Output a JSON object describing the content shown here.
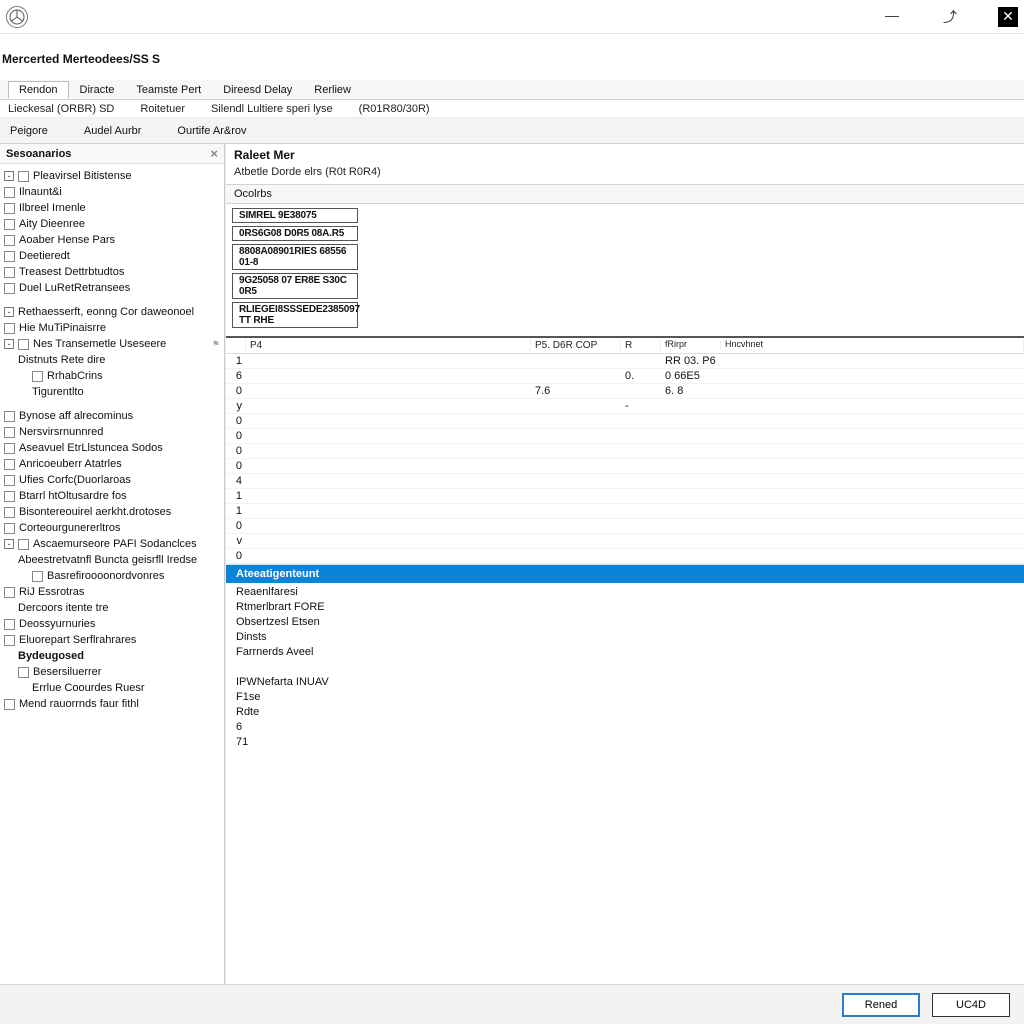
{
  "title": "Mercerted Merteodees/SS S",
  "window_controls": {
    "minimize": "—",
    "restore": "⤴",
    "close": "✕"
  },
  "ribbon": {
    "tabs": [
      "Rendon",
      "Diracte",
      "Teamste Pert",
      "Direesd Delay",
      "Rerliew"
    ],
    "sub": {
      "a": "Lieckesal (ORBR) SD",
      "b": "Roitetuer",
      "c": "Silendl Lultiere speri lyse",
      "d": "(R01R80/30R)"
    }
  },
  "toolbar": {
    "a": "Peigore",
    "b": "Audel Aurbr",
    "c": "Ourtife Ar&rov"
  },
  "sidebar": {
    "title": "Sesoanarios",
    "nodes": [
      {
        "exp": "-",
        "icon": true,
        "label": "Pleavirsel Bitistense",
        "indent": 0
      },
      {
        "icon": true,
        "label": "Ilnaunt&i",
        "indent": 0
      },
      {
        "icon": true,
        "label": "Ilbreel Irnenle",
        "indent": 0
      },
      {
        "icon": true,
        "label": "Aity Dieenree",
        "indent": 0
      },
      {
        "icon": true,
        "label": "Aoaber Hense Pars",
        "indent": 0
      },
      {
        "icon": true,
        "label": "Deetieredt",
        "indent": 0
      },
      {
        "icon": true,
        "label": "Treasest Dettrbtudtos",
        "indent": 0
      },
      {
        "icon": true,
        "label": "Duel LuRetRetransees",
        "indent": 0
      },
      {
        "blank": true
      },
      {
        "exp": "-",
        "label": "Rethaesserft, eonng Cor daweonoel",
        "indent": 0
      },
      {
        "icon": true,
        "label": "Hie MuTiPinaisrre",
        "indent": 0
      },
      {
        "exp": "-",
        "icon": true,
        "label": "Nes Transemetle Useseere",
        "indent": 0,
        "pin": true
      },
      {
        "label": "Distnuts Rete dire",
        "indent": 1
      },
      {
        "icon": true,
        "label": "RrhabCrins",
        "indent": 2
      },
      {
        "label": "Tigurentlto",
        "indent": 2
      },
      {
        "blank": true
      },
      {
        "icon": true,
        "label": "Bynose aff alrecominus",
        "indent": 0
      },
      {
        "icon": true,
        "label": "Nersvirsrnunnred",
        "indent": 0
      },
      {
        "icon": true,
        "label": "Aseavuel EtrLlstuncea Sodos",
        "indent": 0
      },
      {
        "icon": true,
        "label": "Anricoeuberr Atatrles",
        "indent": 0
      },
      {
        "icon": true,
        "label": "Ufies Corfc(Duorlaroas",
        "indent": 0
      },
      {
        "icon": true,
        "label": "Btarrl htOltusardre fos",
        "indent": 0
      },
      {
        "icon": true,
        "label": "Bisontereouirel aerkht.drotoses",
        "indent": 0
      },
      {
        "icon": true,
        "label": "Corteourgunererltros",
        "indent": 0
      },
      {
        "exp": "-",
        "icon": true,
        "label": "Ascaemurseore PAFI Sodanclces",
        "indent": 0
      },
      {
        "label": "Abeestretvatnfl Buncta geisrfll Iredse",
        "indent": 1
      },
      {
        "icon": true,
        "label": "Basrefiroooonordvonres",
        "indent": 2
      },
      {
        "icon": true,
        "label": "RiJ Essrotras",
        "indent": 0
      },
      {
        "label": "Dercoors itente tre",
        "indent": 1
      },
      {
        "icon": true,
        "label": "Deossyurnuries",
        "indent": 0
      },
      {
        "icon": true,
        "label": "Eluorepart Serflrahrares",
        "indent": 0
      },
      {
        "label": "Bydeugosed",
        "indent": 1,
        "bold": true
      },
      {
        "icon": true,
        "label": "Besersiluerrer",
        "indent": 1
      },
      {
        "label": "Errlue Coourdes Ruesr",
        "indent": 2
      },
      {
        "icon": true,
        "label": "Mend rauorrnds faur fithl",
        "indent": 0
      }
    ]
  },
  "content": {
    "header": "Raleet Mer",
    "subheader": "Atbetle Dorde elrs (R0t R0R4)",
    "section": "Ocolrbs",
    "commands": [
      "SIMREL 9E38075",
      "0RS6G08 D0R5 08A.R5",
      "8808A08901RIES 68556 01-8",
      "9G25058 07 ER8E S30C 0R5",
      "RLIEGEI8SSSEDE2385097 TT RHE"
    ],
    "grid": {
      "headers": {
        "c0": "",
        "c1": "P4",
        "c2": "P5. D6R COP",
        "c3": "R",
        "c4": "fRirpr",
        "c5": "Hncvhnet"
      },
      "rows": [
        {
          "c0": "1",
          "c1": "",
          "c2": "",
          "c3": "",
          "c4": "RR 03. P6",
          "c5": ""
        },
        {
          "c0": "6",
          "c1": "",
          "c2": "",
          "c3": "0.",
          "c4": "0 66E5",
          "c5": ""
        },
        {
          "c0": "0",
          "c1": "",
          "c2": "7.6",
          "c3": "",
          "c4": "6. 8",
          "c5": ""
        },
        {
          "c0": "y",
          "c1": "",
          "c2": "",
          "c3": "-",
          "c4": "",
          "c5": ""
        },
        {
          "c0": "0"
        },
        {
          "c0": "0"
        },
        {
          "c0": "0"
        },
        {
          "c0": "0"
        },
        {
          "c0": "4"
        },
        {
          "c0": "1"
        },
        {
          "c0": "1"
        },
        {
          "c0": "0"
        },
        {
          "c0": "v"
        },
        {
          "c0": "0"
        }
      ]
    },
    "blue_header": "Ateeatigenteunt",
    "details": [
      "Reaenlfaresi",
      "Rtmerlbrart FORE",
      "Obsertzesl Etsen",
      "Dinsts",
      "Farrnerds Aveel",
      "",
      "IPWNefarta INUAV",
      "F1se",
      "Rdte",
      "6",
      "71"
    ]
  },
  "footer": {
    "primary": "Rened",
    "secondary": "UC4D"
  }
}
